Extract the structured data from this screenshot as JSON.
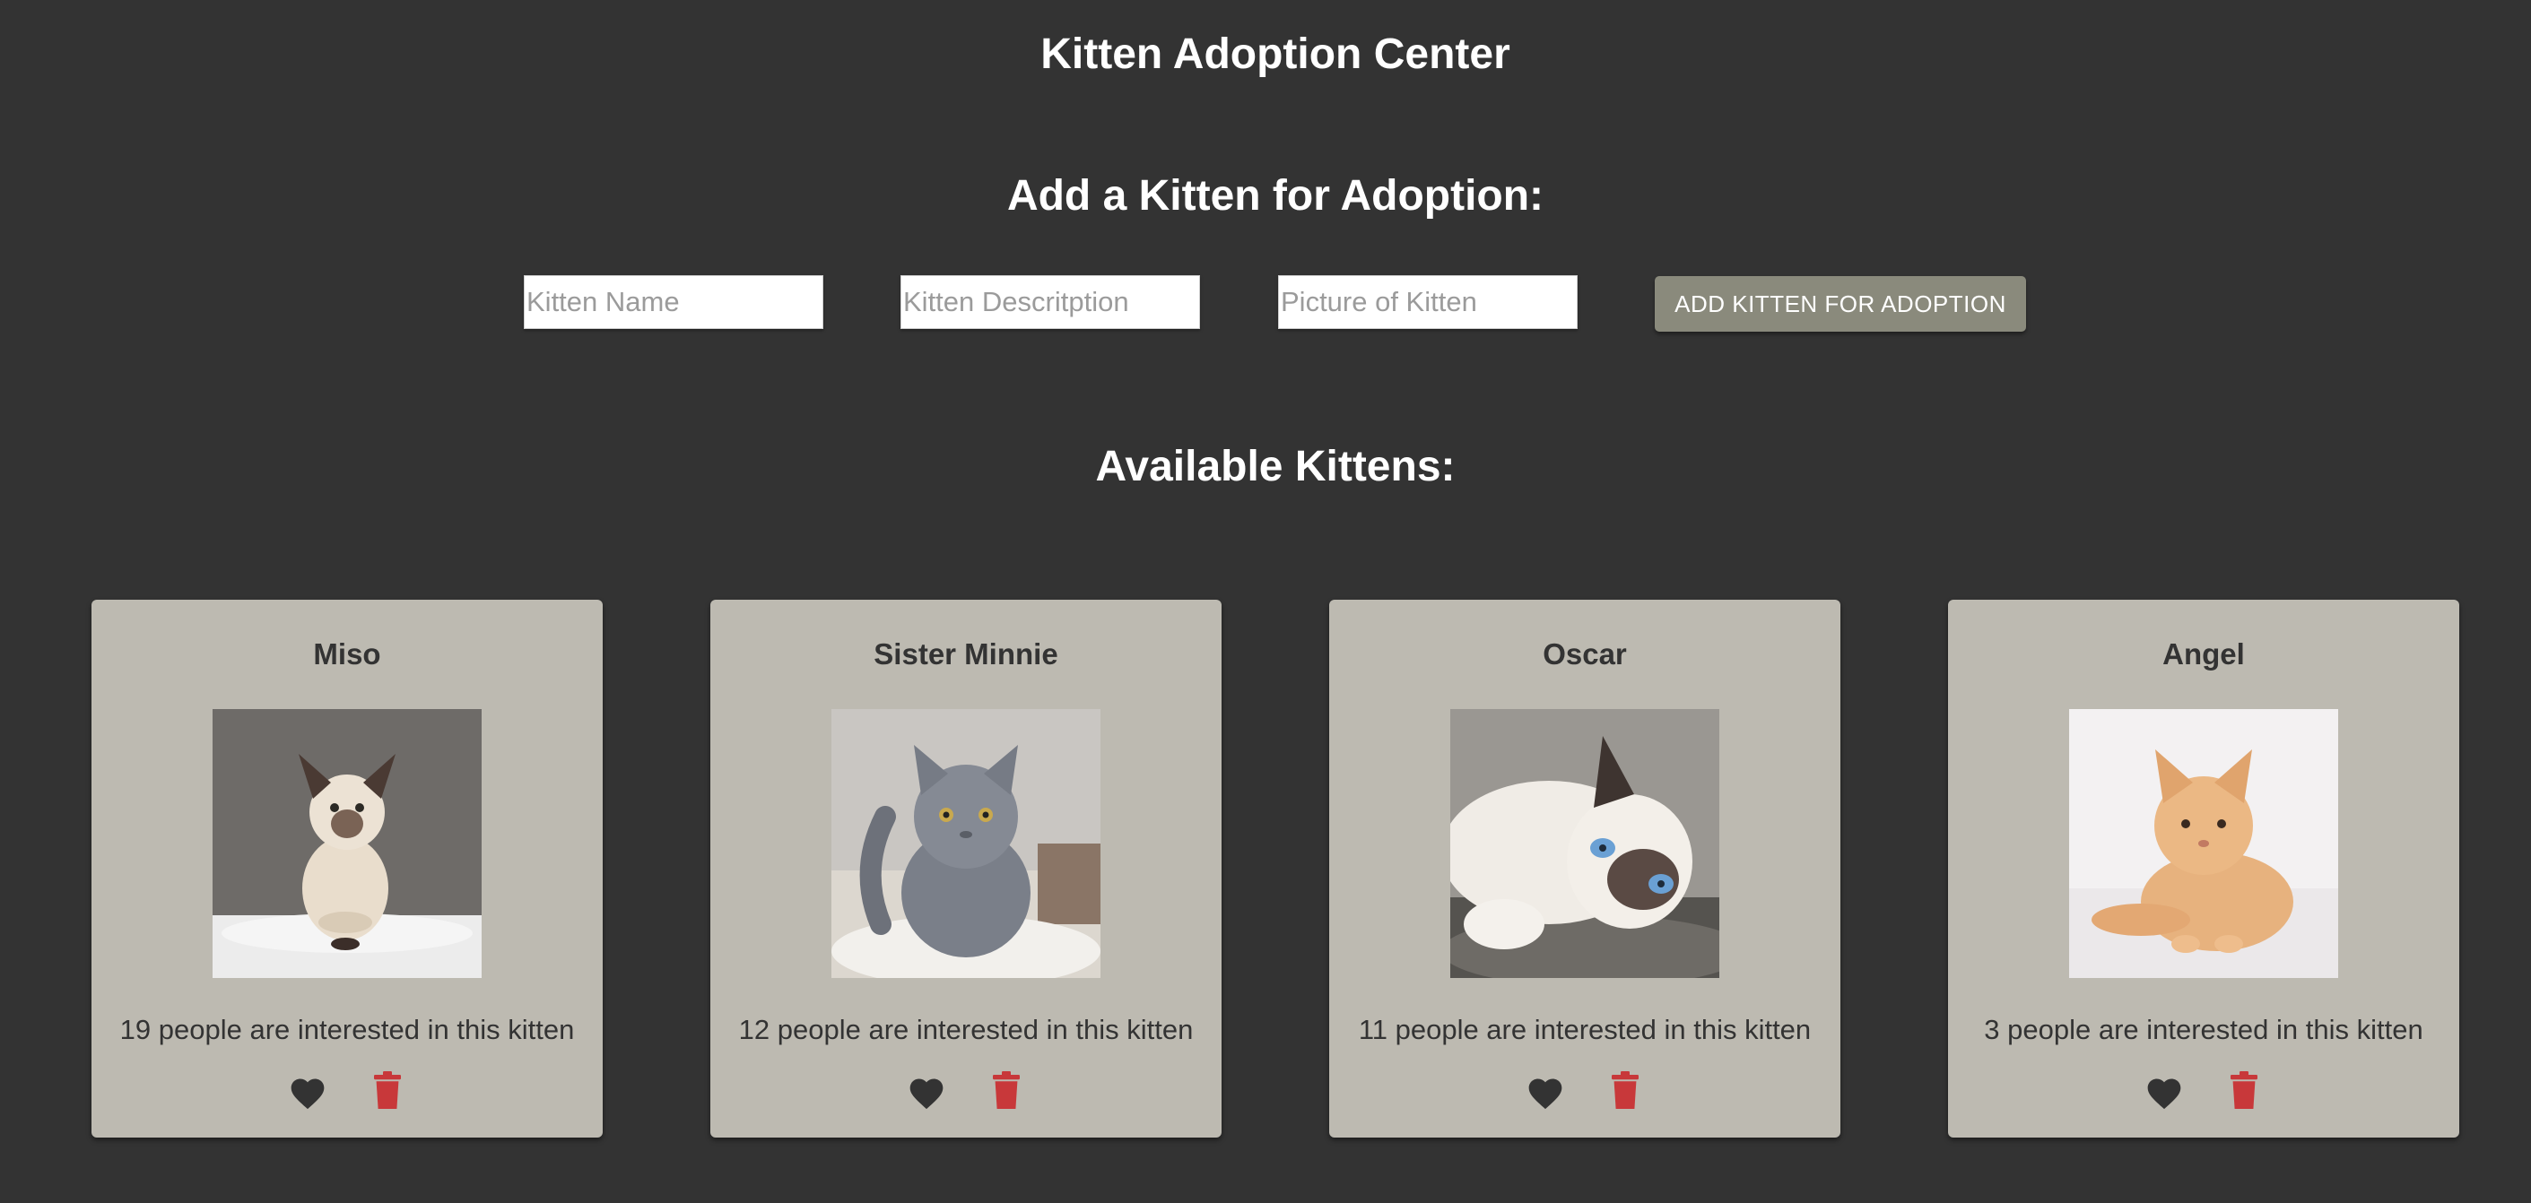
{
  "header": {
    "title": "Kitten Adoption Center"
  },
  "add_form": {
    "heading": "Add a Kitten for Adoption:",
    "name_placeholder": "Kitten Name",
    "description_placeholder": "Kitten Descritption",
    "picture_placeholder": "Picture of Kitten",
    "submit_label": "ADD KITTEN FOR ADOPTION"
  },
  "kittens_section": {
    "heading": "Available Kittens:",
    "kittens": [
      {
        "name": "Miso",
        "interest": "19 people are interested in this kitten",
        "photo": "siamese-kitten-photo"
      },
      {
        "name": "Sister Minnie",
        "interest": "12 people are interested in this kitten",
        "photo": "gray-british-shorthair-kitten-photo"
      },
      {
        "name": "Oscar",
        "interest": "11 people are interested in this kitten",
        "photo": "ragdoll-kitten-photo"
      },
      {
        "name": "Angel",
        "interest": "3 people are interested in this kitten",
        "photo": "orange-fluffy-kitten-photo"
      }
    ]
  },
  "icons": {
    "like": "heart-icon",
    "delete": "trash-icon"
  },
  "colors": {
    "background": "#333333",
    "card": "#bdbab1",
    "button": "#8a8a7c",
    "heart": "#333333",
    "trash": "#c8383a",
    "text_light": "#ffffff",
    "text_dark": "#333333"
  }
}
